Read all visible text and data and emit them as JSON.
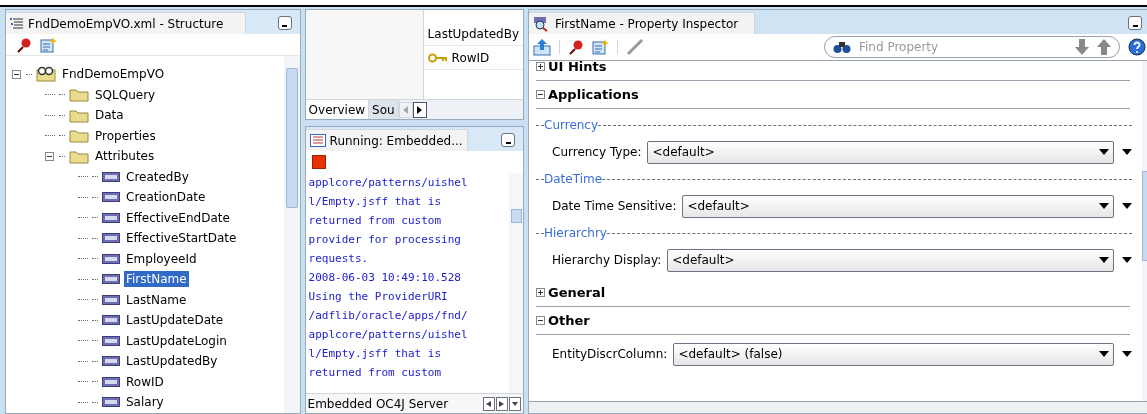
{
  "structure_panel": {
    "title": "FndDemoEmpVO.xml - Structure",
    "tree": [
      {
        "label": "FndDemoEmpVO",
        "kind": "object",
        "expanded": true,
        "selected": false,
        "children": [
          {
            "label": "SQLQuery",
            "kind": "folder",
            "selected": false
          },
          {
            "label": "Data",
            "kind": "folder",
            "selected": false
          },
          {
            "label": "Properties",
            "kind": "folder",
            "selected": false
          },
          {
            "label": "Attributes",
            "kind": "folder",
            "expanded": true,
            "selected": false,
            "children": [
              {
                "label": "CreatedBy",
                "kind": "attribute",
                "selected": false
              },
              {
                "label": "CreationDate",
                "kind": "attribute",
                "selected": false
              },
              {
                "label": "EffectiveEndDate",
                "kind": "attribute",
                "selected": false
              },
              {
                "label": "EffectiveStartDate",
                "kind": "attribute",
                "selected": false
              },
              {
                "label": "EmployeeId",
                "kind": "attribute",
                "selected": false
              },
              {
                "label": "FirstName",
                "kind": "attribute",
                "selected": true
              },
              {
                "label": "LastName",
                "kind": "attribute",
                "selected": false
              },
              {
                "label": "LastUpdateDate",
                "kind": "attribute",
                "selected": false
              },
              {
                "label": "LastUpdateLogin",
                "kind": "attribute",
                "selected": false
              },
              {
                "label": "LastUpdatedBy",
                "kind": "attribute",
                "selected": false
              },
              {
                "label": "RowID",
                "kind": "attribute",
                "selected": false
              },
              {
                "label": "Salary",
                "kind": "attribute",
                "selected": false
              }
            ]
          }
        ]
      }
    ]
  },
  "editor_panel": {
    "list": [
      {
        "label": "LastUpdatedBy",
        "kind": "plain"
      },
      {
        "label": "RowID",
        "kind": "key"
      }
    ],
    "tabs": [
      {
        "label": "Overview",
        "selected": true
      },
      {
        "label": "Sou",
        "selected": false
      }
    ]
  },
  "log_panel": {
    "title": "Running: Embedded...",
    "lines": [
      "applcore/patterns/uishel",
      "l/Empty.jsff that is",
      "returned from custom",
      "provider for processing",
      "requests.",
      "2008-06-03 10:49:10.528",
      "Using the ProviderURI",
      "/adflib/oracle/apps/fnd/",
      "applcore/patterns/uishel",
      "l/Empty.jsff that is",
      "returned from custom"
    ],
    "status": "Embedded OC4J Server"
  },
  "property_inspector": {
    "title": "FirstName - Property Inspector",
    "search": {
      "placeholder": "Find Property"
    },
    "sections": [
      {
        "title": "UI Hints",
        "expanded": false
      },
      {
        "title": "Applications",
        "expanded": true,
        "items": [
          {
            "kind": "group",
            "label": "Currency"
          },
          {
            "kind": "field",
            "label": "Currency Type:",
            "value": "<default>"
          },
          {
            "kind": "group",
            "label": "DateTime"
          },
          {
            "kind": "field",
            "label": "Date Time Sensitive:",
            "value": "<default>"
          },
          {
            "kind": "group",
            "label": "Hierarchry"
          },
          {
            "kind": "field",
            "label": "Hierarchy Display:",
            "value": "<default>"
          }
        ]
      },
      {
        "title": "General",
        "expanded": false
      },
      {
        "title": "Other",
        "expanded": true,
        "items": [
          {
            "kind": "field",
            "label": "EntityDiscrColumn:",
            "value": "<default> (false)"
          }
        ]
      }
    ]
  }
}
